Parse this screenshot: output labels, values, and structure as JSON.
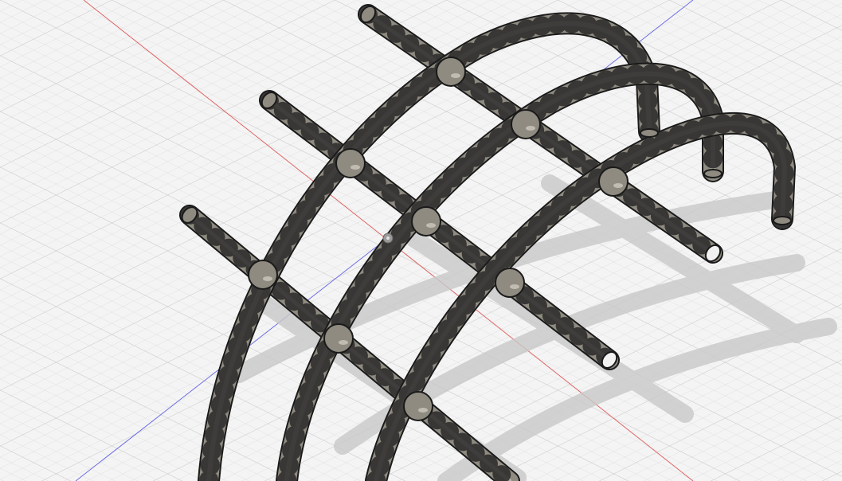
{
  "viewport": {
    "kind": "3d-modeling-canvas",
    "background_color": "#f4f4f4",
    "grid": {
      "visible": true,
      "minor_color": "#dcdcdc",
      "major_color": "#c4c4c4"
    },
    "axes": {
      "x_axis_color": "#e06666",
      "z_axis_color": "#6f6fe6"
    },
    "origin_marker_icon": "origin-point-icon"
  },
  "model": {
    "shape": "curved-tube-lattice",
    "arches": 3,
    "cross_tubes": 3,
    "tube_color": "#8f8b81",
    "tube_highlight": "#cdc9bf",
    "outline_color": "#1a1a1a",
    "shadow_color": "#c8c8c8"
  }
}
